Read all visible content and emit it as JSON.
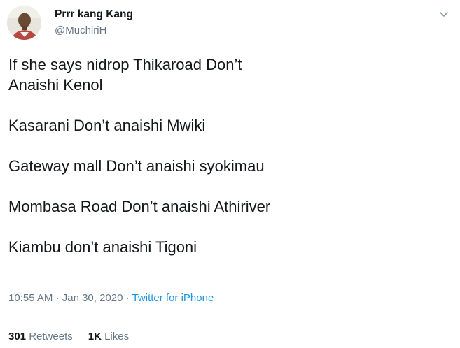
{
  "author": {
    "display_name": "Prrr kang Kang",
    "handle": "@MuchiriH"
  },
  "tweet": {
    "paragraphs": [
      [
        "If she says nidrop Thikaroad Don’t",
        "Anaishi Kenol"
      ],
      [
        "Kasarani Don’t anaishi Mwiki"
      ],
      [
        "Gateway mall Don’t anaishi syokimau"
      ],
      [
        "Mombasa Road Don’t anaishi Athiriver"
      ],
      [
        "Kiambu don’t anaishi Tigoni"
      ]
    ]
  },
  "meta": {
    "time": "10:55 AM",
    "separator": "·",
    "date": "Jan 30, 2020",
    "source": "Twitter for iPhone"
  },
  "stats": {
    "retweets_count": "301",
    "retweets_label": "Retweets",
    "likes_count": "1K",
    "likes_label": "Likes"
  },
  "icons": {
    "caret": "chevron-down-icon"
  },
  "colors": {
    "text": "#14171a",
    "secondary": "#657786",
    "link": "#1b95e0",
    "divider": "#e6ecf0"
  }
}
